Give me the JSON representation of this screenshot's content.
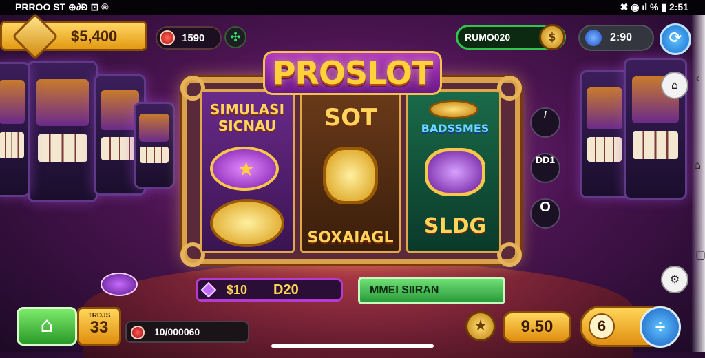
{
  "status_bar": {
    "left_text": "PRROO ST ⊕∂Ð ⊡ ®",
    "right_text": "✖ ◉ ıl % ▮ 2:51"
  },
  "hud": {
    "coins": "$5,400",
    "gems": "1590",
    "rank_label": "RUMO020",
    "level": "2:90"
  },
  "title": "PROSLOT",
  "reels": {
    "reel1_text": "SIMULASI SICNAU",
    "reel2_top": "SOT",
    "reel2_bottom": "SOXAIAGL",
    "reel3_top": "BADSSMES",
    "reel3_bottom": "SLDG"
  },
  "bet": {
    "amount": "$10",
    "total": "D20"
  },
  "spin_button": "MMEI SIIRAN",
  "bottom": {
    "bonus_label": "TRDJS",
    "bonus_value": "33",
    "balance": "10/000060",
    "price": "9.50",
    "lines": "6",
    "lines_button": "÷"
  },
  "side_buttons": {
    "slash": "/",
    "dd": "DD1",
    "ring": "O"
  },
  "colors": {
    "accent_gold": "#ffd23a",
    "purple": "#6a178a",
    "green": "#33c450",
    "blue": "#1a6fd0"
  }
}
